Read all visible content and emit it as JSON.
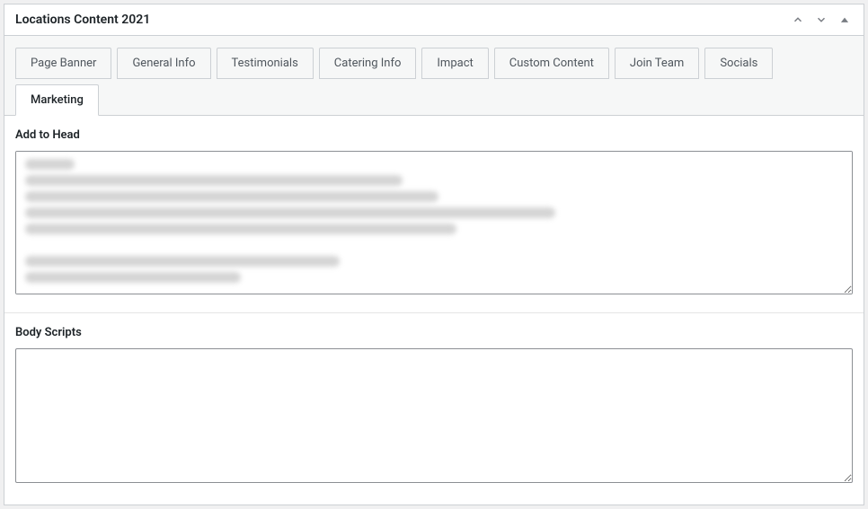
{
  "panel": {
    "title": "Locations Content 2021"
  },
  "tabs": [
    {
      "label": "Page Banner",
      "active": false
    },
    {
      "label": "General Info",
      "active": false
    },
    {
      "label": "Testimonials",
      "active": false
    },
    {
      "label": "Catering Info",
      "active": false
    },
    {
      "label": "Impact",
      "active": false
    },
    {
      "label": "Custom Content",
      "active": false
    },
    {
      "label": "Join Team",
      "active": false
    },
    {
      "label": "Socials",
      "active": false
    },
    {
      "label": "Marketing",
      "active": true
    }
  ],
  "fields": {
    "add_to_head": {
      "label": "Add to Head",
      "value": ""
    },
    "body_scripts": {
      "label": "Body Scripts",
      "value": ""
    }
  }
}
